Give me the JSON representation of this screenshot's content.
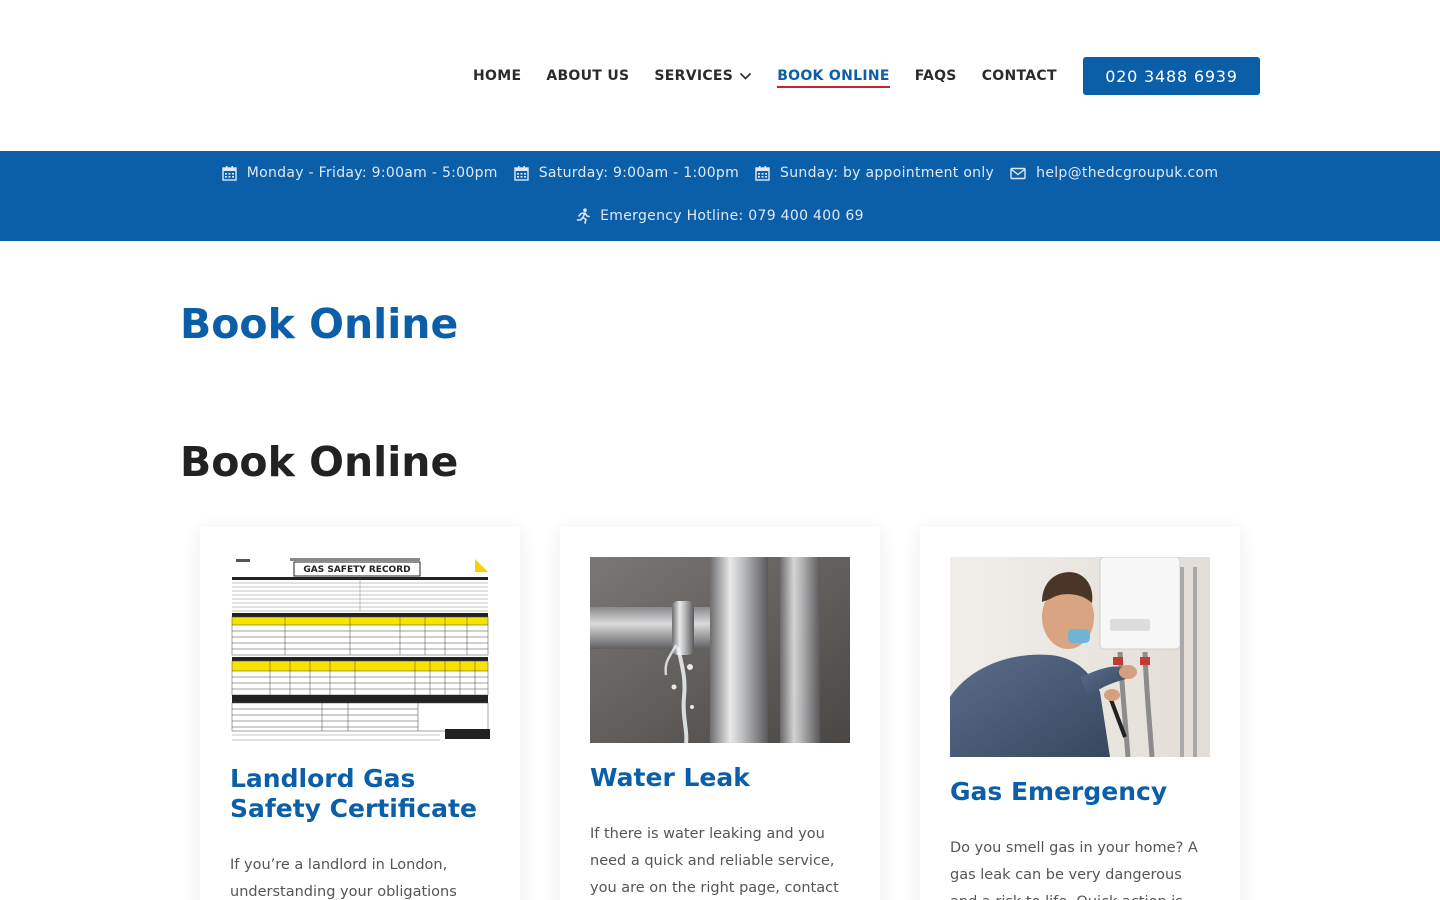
{
  "nav": {
    "items": [
      {
        "label": "HOME"
      },
      {
        "label": "ABOUT US"
      },
      {
        "label": "SERVICES"
      },
      {
        "label": "BOOK ONLINE"
      },
      {
        "label": "FAQS"
      },
      {
        "label": "CONTACT"
      }
    ],
    "active": "BOOK ONLINE",
    "phone": "020 3488 6939"
  },
  "infobar": {
    "weekday": "Monday - Friday: 9:00am - 5:00pm",
    "saturday": "Saturday: 9:00am - 1:00pm",
    "sunday": "Sunday: by appointment only",
    "email": "help@thedcgroupuk.com",
    "emergency": "Emergency Hotline: 079 400 400 69"
  },
  "page": {
    "title": "Book Online",
    "section_heading": "Book Online"
  },
  "cards": [
    {
      "title": "Landlord Gas Safety Certificate",
      "text": "If you’re a landlord in London, understanding your obligations",
      "image_label": "GAS SAFETY RECORD"
    },
    {
      "title": "Water Leak",
      "text": "If there is water leaking and you need a quick and reliable service, you are on the right page, contact"
    },
    {
      "title": "Gas Emergency",
      "text": "Do you smell gas in your home? A gas leak can be very dangerous and a risk to life. Quick action is needed"
    }
  ],
  "colors": {
    "brand_blue": "#0b5ea8",
    "active_underline": "#c0262d"
  }
}
